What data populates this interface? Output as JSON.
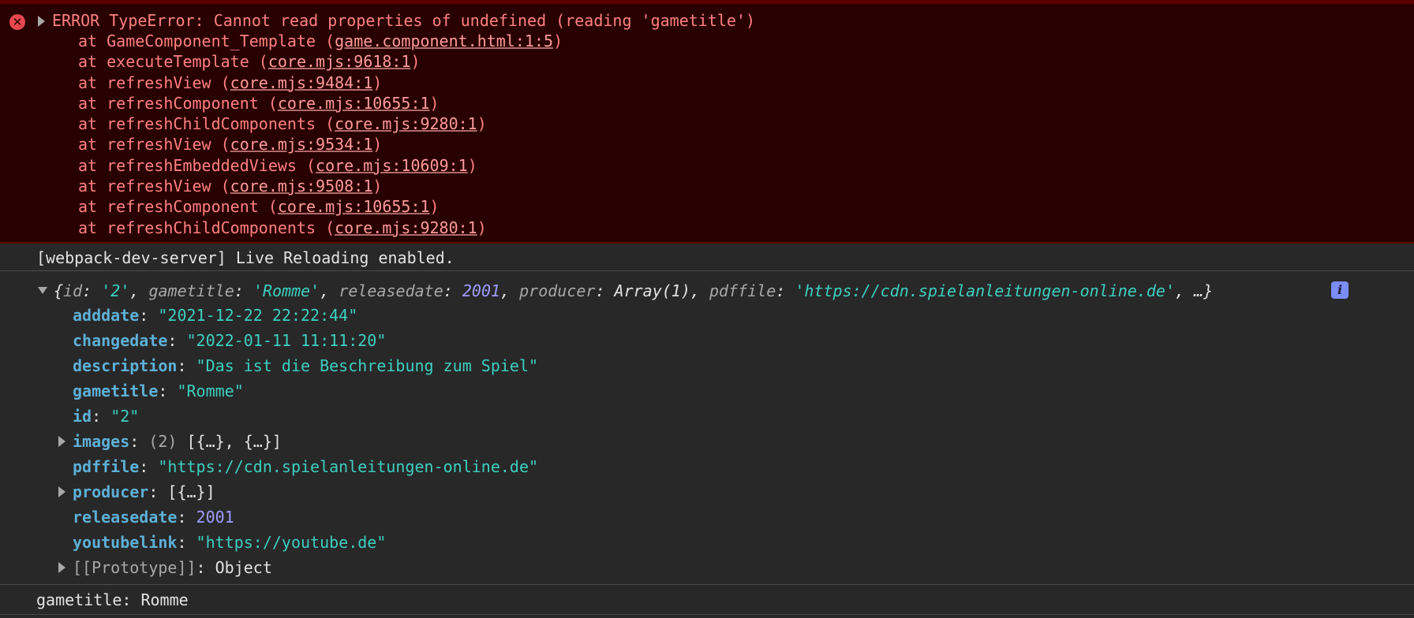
{
  "error": {
    "message": "ERROR TypeError: Cannot read properties of undefined (reading 'gametitle')",
    "stack": [
      {
        "prefix": "at GameComponent_Template (",
        "link": "game.component.html:1:5",
        "suffix": ")"
      },
      {
        "prefix": "at executeTemplate (",
        "link": "core.mjs:9618:1",
        "suffix": ")"
      },
      {
        "prefix": "at refreshView (",
        "link": "core.mjs:9484:1",
        "suffix": ")"
      },
      {
        "prefix": "at refreshComponent (",
        "link": "core.mjs:10655:1",
        "suffix": ")"
      },
      {
        "prefix": "at refreshChildComponents (",
        "link": "core.mjs:9280:1",
        "suffix": ")"
      },
      {
        "prefix": "at refreshView (",
        "link": "core.mjs:9534:1",
        "suffix": ")"
      },
      {
        "prefix": "at refreshEmbeddedViews (",
        "link": "core.mjs:10609:1",
        "suffix": ")"
      },
      {
        "prefix": "at refreshView (",
        "link": "core.mjs:9508:1",
        "suffix": ")"
      },
      {
        "prefix": "at refreshComponent (",
        "link": "core.mjs:10655:1",
        "suffix": ")"
      },
      {
        "prefix": "at refreshChildComponents (",
        "link": "core.mjs:9280:1",
        "suffix": ")"
      }
    ]
  },
  "log_webpack": "[webpack-dev-server] Live Reloading enabled.",
  "object_preview": {
    "open_brace": "{",
    "id_key": "id",
    "id_val": "'2'",
    "gametitle_key": "gametitle",
    "gametitle_val": "'Romme'",
    "releasedate_key": "releasedate",
    "releasedate_val": "2001",
    "producer_key": "producer",
    "producer_val": "Array(1)",
    "pdffile_key": "pdffile",
    "pdffile_val": "'https://cdn.spielanleitungen-online.de'",
    "ellipsis": "…}",
    "sep_colon": ": ",
    "sep_comma": ", ",
    "info_label": "i"
  },
  "properties": {
    "adddate": {
      "key": "adddate",
      "value": "\"2021-12-22 22:22:44\""
    },
    "changedate": {
      "key": "changedate",
      "value": "\"2022-01-11 11:11:20\""
    },
    "description": {
      "key": "description",
      "value": "\"Das ist die Beschreibung zum Spiel\""
    },
    "gametitle": {
      "key": "gametitle",
      "value": "\"Romme\""
    },
    "id": {
      "key": "id",
      "value": "\"2\""
    },
    "images": {
      "key": "images",
      "count": "(2)",
      "value": "[{…}, {…}]"
    },
    "pdffile": {
      "key": "pdffile",
      "value": "\"https://cdn.spielanleitungen-online.de\""
    },
    "producer": {
      "key": "producer",
      "value": "[{…}]"
    },
    "releasedate": {
      "key": "releasedate",
      "value": "2001"
    },
    "youtubelink": {
      "key": "youtubelink",
      "value": "\"https://youtube.de\""
    },
    "prototype": {
      "key": "[[Prototype]]",
      "value": "Object"
    }
  },
  "log_gametitle": "gametitle: Romme",
  "icons": {
    "error": "error-circle-icon",
    "expand": "triangle-right-icon",
    "collapse": "triangle-down-icon",
    "info": "info-icon"
  },
  "colors": {
    "error_bg": "#290000",
    "error_text": "#ff8080",
    "console_bg": "#282828",
    "string": "#3cd0c0",
    "number": "#a09cff",
    "key": "#5db0d7"
  }
}
